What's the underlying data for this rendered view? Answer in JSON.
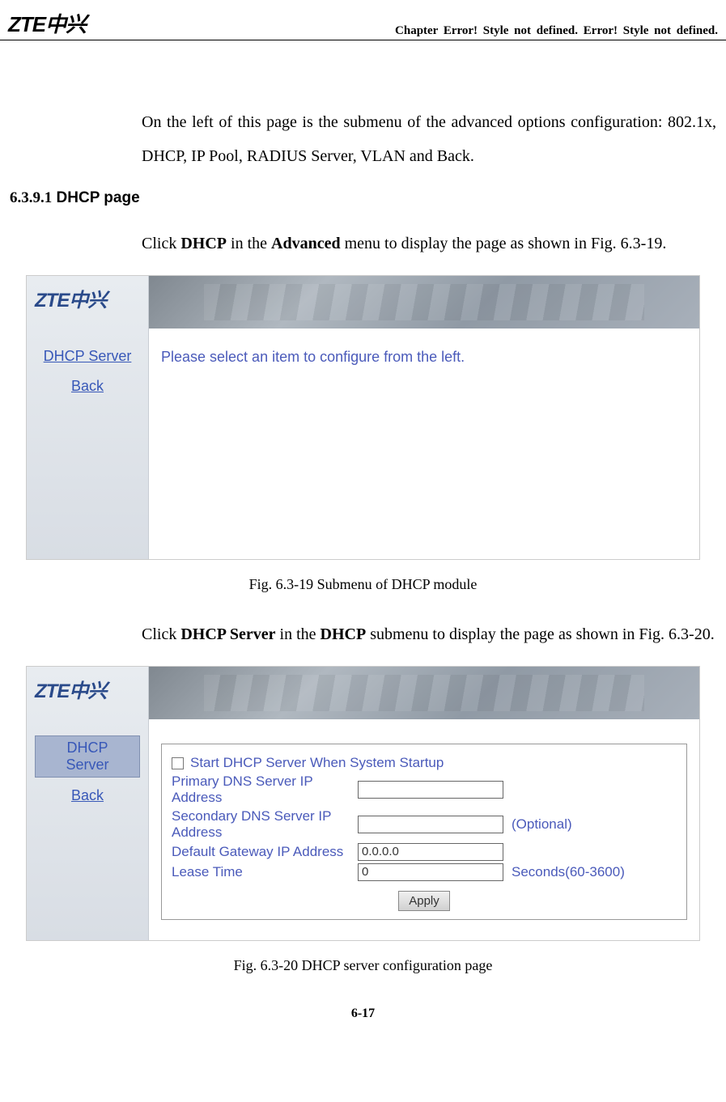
{
  "header": {
    "logo_text": "ZTE中兴",
    "chapter_text": "Chapter  Error!  Style  not  defined.    Error!  Style  not  defined."
  },
  "intro_para": "On the left of this page is the submenu of the advanced options configuration: 802.1x, DHCP, IP Pool, RADIUS Server, VLAN and Back.",
  "section": {
    "number": "6.3.9.1",
    "title": "DHCP page"
  },
  "click_line_1": {
    "pre": "Click ",
    "bold1": "DHCP",
    "mid": " in the ",
    "bold2": "Advanced",
    "post": " menu to display the page as shown in Fig. 6.3-19."
  },
  "figure1": {
    "sidebar_logo": "ZTE中兴",
    "links": {
      "dhcp_server": "DHCP Server",
      "back": "Back"
    },
    "prompt": "Please select an item to configure from the left.",
    "caption": "Fig. 6.3-19    Submenu of DHCP module"
  },
  "click_line_2": {
    "pre": "Click ",
    "bold1": "DHCP Server",
    "mid": " in the ",
    "bold2": "DHCP",
    "post": " submenu to display the page as shown in Fig. 6.3-20."
  },
  "figure2": {
    "sidebar_logo": "ZTE中兴",
    "links": {
      "dhcp_server": "DHCP Server",
      "back": "Back"
    },
    "form": {
      "checkbox_label": "Start DHCP Server When System Startup",
      "primary_dns_label": "Primary DNS Server IP Address",
      "primary_dns_value": "",
      "secondary_dns_label": "Secondary DNS Server IP Address",
      "secondary_dns_value": "",
      "secondary_suffix": "(Optional)",
      "gateway_label": "Default Gateway IP Address",
      "gateway_value": "0.0.0.0",
      "lease_label": "Lease Time",
      "lease_value": "0",
      "lease_suffix": "Seconds(60-3600)",
      "apply_label": "Apply"
    },
    "caption": "Fig. 6.3-20    DHCP server configuration page"
  },
  "page_number": "6-17"
}
